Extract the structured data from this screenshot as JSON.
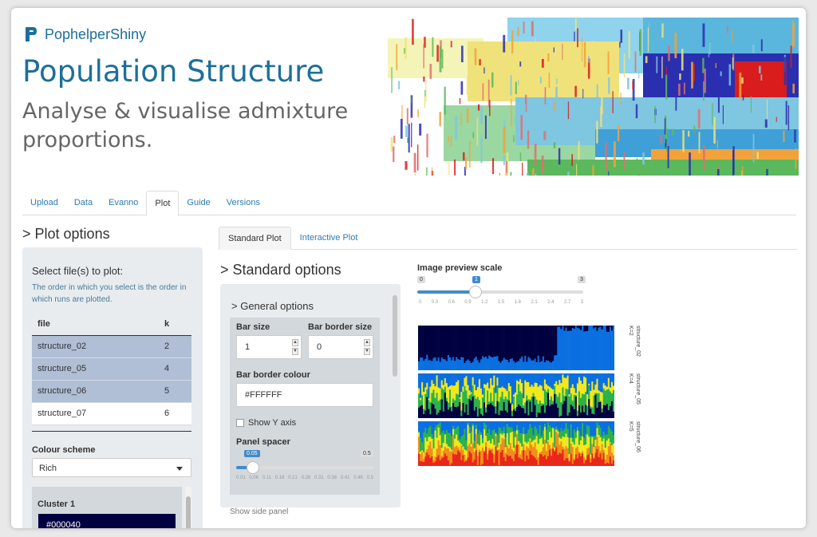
{
  "app": {
    "name": "PophelperShiny"
  },
  "hero": {
    "title": "Population Structure",
    "subtitle": "Analyse & visualise admixture proportions."
  },
  "nav": {
    "tabs": [
      "Upload",
      "Data",
      "Evanno",
      "Plot",
      "Guide",
      "Versions"
    ],
    "active": "Plot"
  },
  "plot_options": {
    "title": "> Plot options",
    "select_label": "Select file(s) to plot:",
    "select_help": "The order in which you select is the order in which runs are plotted.",
    "table": {
      "headers": [
        "file",
        "k"
      ],
      "rows": [
        {
          "file": "structure_02",
          "k": "2",
          "selected": true
        },
        {
          "file": "structure_05",
          "k": "4",
          "selected": true
        },
        {
          "file": "structure_06",
          "k": "5",
          "selected": true
        },
        {
          "file": "structure_07",
          "k": "6",
          "selected": false
        }
      ]
    },
    "colour_scheme": {
      "label": "Colour scheme",
      "value": "Rich"
    },
    "cluster1": {
      "label": "Cluster 1",
      "value": "#000040"
    }
  },
  "subtabs": [
    "Standard Plot",
    "Interactive Plot"
  ],
  "standard_options": {
    "title": "> Standard options",
    "general_title": "> General options",
    "bar_size": {
      "label": "Bar size",
      "value": "1"
    },
    "bar_border_size": {
      "label": "Bar border size",
      "value": "0"
    },
    "bar_border_colour": {
      "label": "Bar border colour",
      "value": "#FFFFFF"
    },
    "show_y_axis": "Show Y axis",
    "panel_spacer": {
      "label": "Panel spacer",
      "min": "0",
      "max": "0.5",
      "value": "0.05",
      "ticks": [
        "0.01",
        "0.06",
        "0.11",
        "0.16",
        "0.21",
        "0.26",
        "0.31",
        "0.36",
        "0.41",
        "0.46",
        "0.5"
      ]
    },
    "show_side_panel": "Show side panel"
  },
  "preview": {
    "label": "Image preview scale",
    "min": "0",
    "max": "3",
    "value": "1",
    "ticks": [
      "0",
      "0.3",
      "0.6",
      "0.9",
      "1.2",
      "1.5",
      "1.8",
      "2.1",
      "2.4",
      "2.7",
      "3"
    ]
  },
  "plots": [
    {
      "name": "structure_02",
      "k": "K=2"
    },
    {
      "name": "structure_05",
      "k": "K=4"
    },
    {
      "name": "structure_06",
      "k": "K=5"
    }
  ],
  "colors": {
    "accent": "#1d6f9a",
    "link": "#2c7bb6",
    "selected_row": "#b0bed6"
  }
}
